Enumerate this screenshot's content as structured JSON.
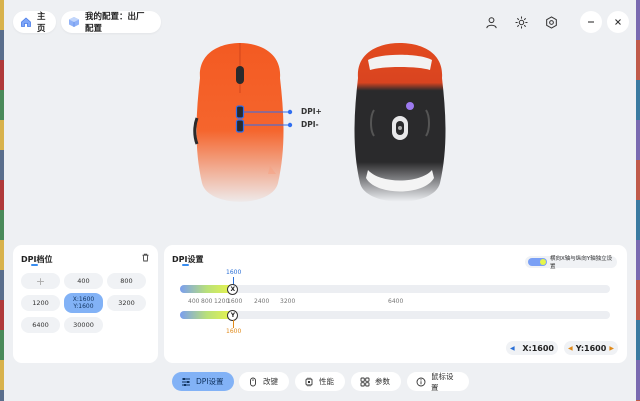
{
  "header": {
    "home_label": "主页",
    "config_label": "我的配置：出厂配置"
  },
  "mouse": {
    "dpi_plus": "DPI+",
    "dpi_minus": "DPI-",
    "body_color": "#f05a2a",
    "accent_color": "#2f6ef0"
  },
  "dpi_panel": {
    "title": "DPI档位",
    "add_symbol": "+",
    "levels": [
      "400",
      "800",
      "1200",
      "X:1600",
      "Y:1600",
      "3200",
      "6400",
      "30000"
    ]
  },
  "dpi_settings": {
    "title": "DPI设置",
    "toggle_label": "横向X轴与纵向Y轴独立设置",
    "x_value_label": "1600",
    "y_value_label": "1600",
    "x_knob": "X",
    "y_knob": "Y",
    "ticks": [
      "400",
      "800",
      "1200",
      "1600",
      "2400",
      "3200",
      "6400"
    ],
    "x_fill_fraction": 0.123,
    "y_fill_fraction": 0.123,
    "x_readout": "X:1600",
    "y_readout": "Y:1600"
  },
  "tabs": [
    {
      "label": "DPI设置",
      "icon": "sliders-icon"
    },
    {
      "label": "改键",
      "icon": "mouse-icon"
    },
    {
      "label": "性能",
      "icon": "chip-icon"
    },
    {
      "label": "参数",
      "icon": "grid-icon"
    },
    {
      "label": "鼠标设置",
      "icon": "info-icon"
    }
  ]
}
